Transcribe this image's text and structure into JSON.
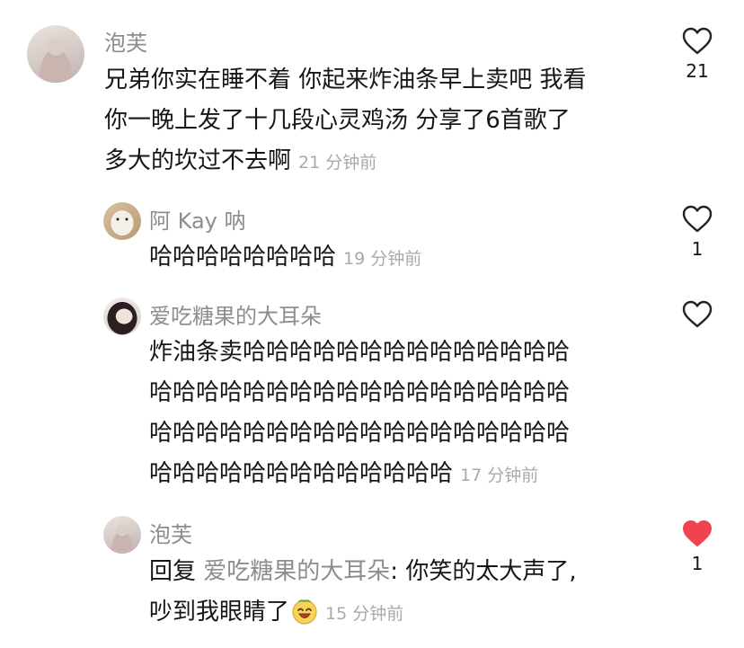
{
  "comments": [
    {
      "author": "泡芙",
      "text": "兄弟你实在睡不着 你起来炸油条早上卖吧 我看你一晚上发了十几段心灵鸡汤 分享了6首歌了多大的坎过不去啊",
      "lines": [
        "兄弟你实在睡不着 你起来炸油条早上卖吧 我看",
        "你一晚上发了十几段心灵鸡汤 分享了6首歌了",
        "多大的坎过不去啊"
      ],
      "time": "21 分钟前",
      "likes": "21",
      "liked": false
    },
    {
      "author": "阿 Kay 呐",
      "text": "哈哈哈哈哈哈哈哈",
      "time": "19 分钟前",
      "likes": "1",
      "liked": false
    },
    {
      "author": "爱吃糖果的大耳朵",
      "lines": [
        "炸油条卖哈哈哈哈哈哈哈哈哈哈哈哈哈哈",
        "哈哈哈哈哈哈哈哈哈哈哈哈哈哈哈哈哈哈",
        "哈哈哈哈哈哈哈哈哈哈哈哈哈哈哈哈哈哈",
        "哈哈哈哈哈哈哈哈哈哈哈哈哈"
      ],
      "time": "17 分钟前",
      "likes": "",
      "liked": false
    },
    {
      "author": "泡芙",
      "reply_prefix": "回复",
      "reply_to": "爱吃糖果的大耳朵",
      "lines": [
        ": 你笑的太大声了,",
        "吵到我眼睛了"
      ],
      "emoji": "laughing-face-emoji",
      "time": "15 分钟前",
      "likes": "1",
      "liked": true
    }
  ],
  "colors": {
    "liked": "#f0434f",
    "muted": "#8d8d8d",
    "time": "#a9a9a9"
  }
}
